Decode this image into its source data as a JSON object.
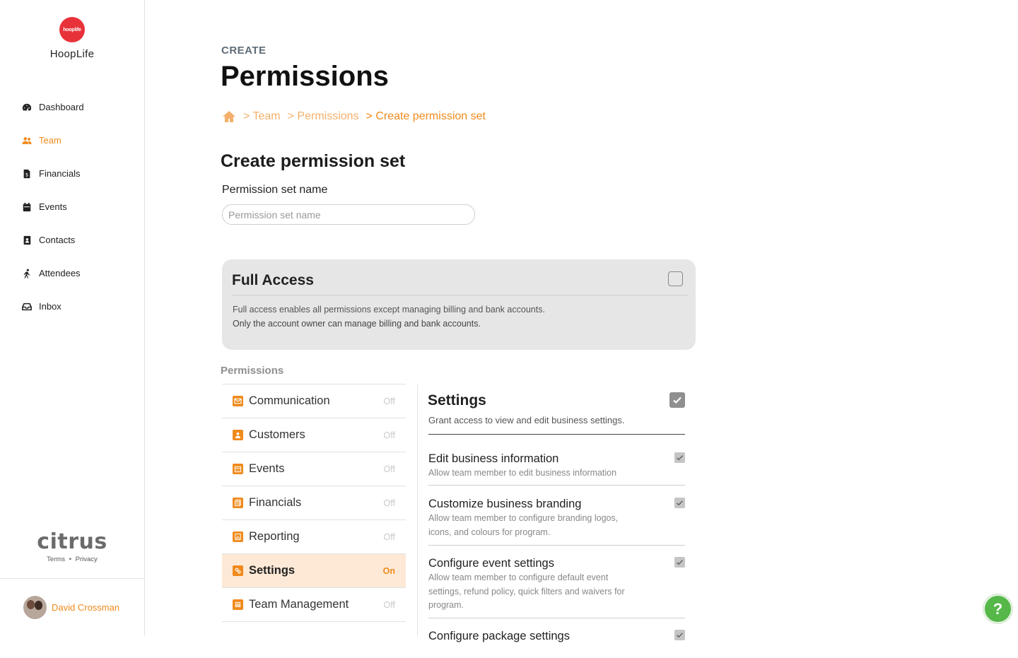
{
  "sidebar": {
    "logo_text": "hooplife",
    "brand_name": "HoopLife",
    "items": [
      {
        "label": "Dashboard",
        "icon": "dashboard-icon"
      },
      {
        "label": "Team",
        "icon": "team-icon"
      },
      {
        "label": "Financials",
        "icon": "financials-icon"
      },
      {
        "label": "Events",
        "icon": "events-icon"
      },
      {
        "label": "Contacts",
        "icon": "contacts-icon"
      },
      {
        "label": "Attendees",
        "icon": "attendees-icon"
      },
      {
        "label": "Inbox",
        "icon": "inbox-icon"
      }
    ],
    "active_item": "Team",
    "footer_logo": "citrus",
    "terms": "Terms",
    "separator": "•",
    "privacy": "Privacy",
    "user_name": "David Crossman"
  },
  "header": {
    "eyebrow": "CREATE",
    "title": "Permissions",
    "breadcrumb": [
      "> Team",
      "> Permissions",
      "> Create permission set"
    ]
  },
  "form": {
    "section_title": "Create permission set",
    "name_label": "Permission set name",
    "name_placeholder": "Permission set name",
    "name_value": ""
  },
  "full_access": {
    "title": "Full Access",
    "checked": false,
    "desc_line1": "Full access enables all permissions except managing billing and bank accounts.",
    "desc_line2": "Only the account owner can manage billing and bank accounts."
  },
  "permissions": {
    "heading": "Permissions",
    "items": [
      {
        "label": "Communication",
        "state": "Off"
      },
      {
        "label": "Customers",
        "state": "Off"
      },
      {
        "label": "Events",
        "state": "Off"
      },
      {
        "label": "Financials",
        "state": "Off"
      },
      {
        "label": "Reporting",
        "state": "Off"
      },
      {
        "label": "Settings",
        "state": "On"
      },
      {
        "label": "Team Management",
        "state": "Off"
      }
    ],
    "selected": "Settings"
  },
  "detail": {
    "title": "Settings",
    "checked": true,
    "desc": "Grant access to view and edit business settings.",
    "settings": [
      {
        "title": "Edit business information",
        "desc": "Allow team member to edit business information",
        "checked": true
      },
      {
        "title": "Customize business branding",
        "desc": "Allow team member to configure branding logos, icons, and colours for program.",
        "checked": true
      },
      {
        "title": "Configure event settings",
        "desc": "Allow team member to configure default event settings, refund policy, quick filters and waivers for program.",
        "checked": true
      },
      {
        "title": "Configure package settings",
        "desc": "",
        "checked": true
      }
    ]
  },
  "help": {
    "label": "?"
  },
  "colors": {
    "accent": "#f08a1c",
    "brand_red": "#e8323a",
    "help_green": "#55b848"
  }
}
